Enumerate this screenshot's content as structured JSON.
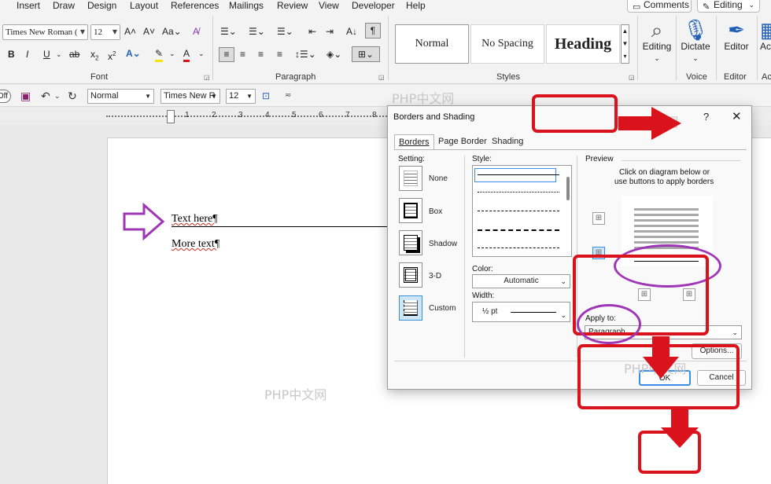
{
  "menu": {
    "items": [
      "Insert",
      "Draw",
      "Design",
      "Layout",
      "References",
      "Mailings",
      "Review",
      "View",
      "Developer",
      "Help"
    ],
    "comments_label": "Comments",
    "editing_label": "Editing"
  },
  "ribbon": {
    "font": {
      "family": "Times New Roman (",
      "size": "12",
      "buttons": [
        "B",
        "I",
        "U",
        "ab",
        "x",
        "x"
      ],
      "group_label": "Font"
    },
    "paragraph": {
      "group_label": "Paragraph"
    },
    "styles": {
      "items": [
        "Normal",
        "No Spacing",
        "Heading"
      ],
      "group_label": "Styles"
    },
    "editing": {
      "label": "Editing"
    },
    "voice": {
      "dictate_label": "Dictate",
      "group_label": "Voice"
    },
    "editor": {
      "label": "Editor",
      "group_label": "Editor"
    },
    "cut_label": "Ac",
    "cut_group": "Ac"
  },
  "qat": {
    "toggle_label": "Off",
    "style_value": "Normal",
    "font_value": "Times New R",
    "size_value": "12"
  },
  "ruler": {
    "numbers": [
      "1",
      "2",
      "3",
      "4",
      "5",
      "6",
      "7",
      "8"
    ]
  },
  "document": {
    "line1": "Text here¶",
    "line2": "More text¶"
  },
  "watermark": "PHP中文网",
  "dialog": {
    "title": "Borders and Shading",
    "help": "?",
    "close": "✕",
    "tabs": [
      "Borders",
      "Page Border",
      "Shading"
    ],
    "setting_label": "Setting:",
    "settings": [
      "None",
      "Box",
      "Shadow",
      "3-D",
      "Custom"
    ],
    "style_label": "Style:",
    "color_label": "Color:",
    "color_value": "Automatic",
    "width_label": "Width:",
    "width_value": "½ pt",
    "preview_label": "Preview",
    "preview_hint_1": "Click on diagram below or",
    "preview_hint_2": "use buttons to apply borders",
    "apply_label": "Apply to:",
    "apply_value": "Paragraph",
    "options_label": "Options...",
    "ok_label": "OK",
    "cancel_label": "Cancel"
  },
  "colors": {
    "annotation_red": "#d9121b",
    "annotation_purple": "#9f36b6",
    "accent_blue": "#1f5fb6"
  }
}
